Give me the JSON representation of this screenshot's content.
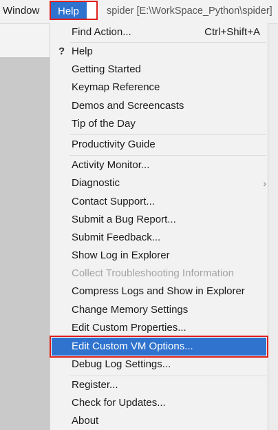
{
  "menubar": {
    "window_label": "Window",
    "help_label": "Help",
    "title": "spider [E:\\WorkSpace_Python\\spider]"
  },
  "help_menu": {
    "find_action": {
      "label": "Find Action...",
      "shortcut": "Ctrl+Shift+A"
    },
    "help_icon": "?",
    "items": [
      "Help",
      "Getting Started",
      "Keymap Reference",
      "Demos and Screencasts",
      "Tip of the Day",
      "Productivity Guide",
      "Activity Monitor...",
      "Diagnostic",
      "Contact Support...",
      "Submit a Bug Report...",
      "Submit Feedback...",
      "Show Log in Explorer",
      "Collect Troubleshooting Information",
      "Compress Logs and Show in Explorer",
      "Change Memory Settings",
      "Edit Custom Properties...",
      "Edit Custom VM Options...",
      "Debug Log Settings...",
      "Register...",
      "Check for Updates...",
      "About"
    ],
    "submenu_arrow": "›",
    "disabled_item": "Collect Troubleshooting Information",
    "selected_item": "Edit Custom VM Options..."
  },
  "colors": {
    "highlight": "#2f73cf",
    "annotation_red": "#e0201a",
    "menu_bg": "#f2f2f2",
    "disabled_text": "#a3a3a3"
  }
}
